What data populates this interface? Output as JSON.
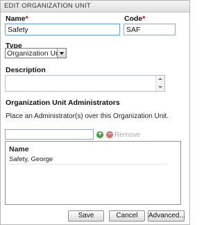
{
  "dialog": {
    "title": "EDIT ORGANIZATION UNIT"
  },
  "form": {
    "name_label": "Name",
    "name_value": "Safety",
    "code_label": "Code",
    "code_value": "SAF",
    "required_mark": "*",
    "type_label": "Type",
    "type_value": "Organization Unit",
    "description_label": "Description",
    "description_value": ""
  },
  "admins": {
    "heading": "Organization Unit Administrators",
    "help_text": "Place an Administrator(s) over this Organization Unit.",
    "search_value": "",
    "remove_label": "Remove",
    "column_header": "Name",
    "rows": [
      {
        "name": "Safety, George"
      }
    ]
  },
  "buttons": {
    "save": "Save",
    "cancel": "Cancel",
    "advanced": "Advanced..."
  },
  "colors": {
    "add": "#3aa53a",
    "remove": "#e06a6a",
    "required": "#c00000"
  }
}
